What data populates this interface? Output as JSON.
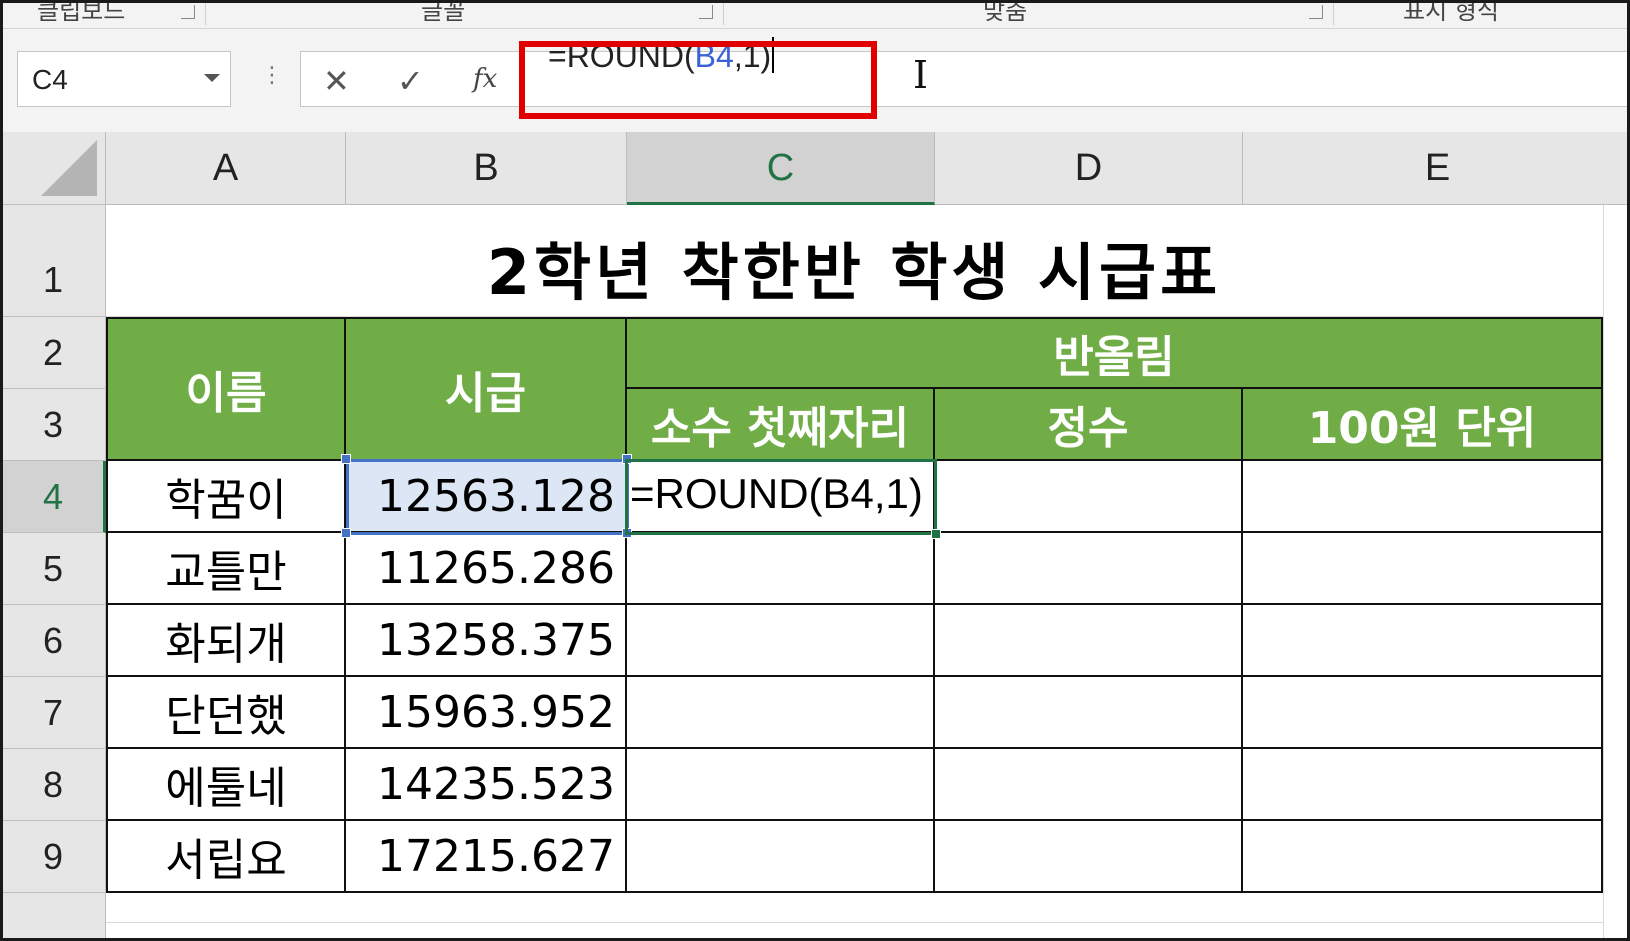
{
  "ribbon_groups": [
    "클립보드",
    "글꼴",
    "맞춤",
    "표시 형식"
  ],
  "name_box": {
    "value": "C4"
  },
  "formula_bar": {
    "cancel_icon": "close-icon",
    "enter_icon": "check-icon",
    "function_label": "fx",
    "formula_prefix": "=ROUND(",
    "formula_ref": "B4",
    "formula_suffix": ",1)"
  },
  "columns": [
    "A",
    "B",
    "C",
    "D",
    "E"
  ],
  "active_column": "C",
  "rows": [
    "1",
    "2",
    "3",
    "4",
    "5",
    "6",
    "7",
    "8",
    "9"
  ],
  "active_row": "4",
  "sheet": {
    "title": "2학년 착한반 학생 시급표",
    "headers": {
      "name": "이름",
      "wage": "시급",
      "rounding": "반올림",
      "first_decimal": "소수 첫째자리",
      "integer": "정수",
      "hundred_won": "100원 단위"
    },
    "data": [
      {
        "name": "학꿈이",
        "wage": "12563.128"
      },
      {
        "name": "교틀만",
        "wage": "11265.286"
      },
      {
        "name": "화되개",
        "wage": "13258.375"
      },
      {
        "name": "단던했",
        "wage": "15963.952"
      },
      {
        "name": "에툴네",
        "wage": "14235.523"
      },
      {
        "name": "서립요",
        "wage": "17215.627"
      }
    ],
    "editing_cell_text": "=ROUND(B4,1)"
  },
  "colors": {
    "header_green": "#70ad47",
    "excel_green": "#217346",
    "ref_blue": "#3a62d6",
    "highlight_red": "#e00000"
  }
}
